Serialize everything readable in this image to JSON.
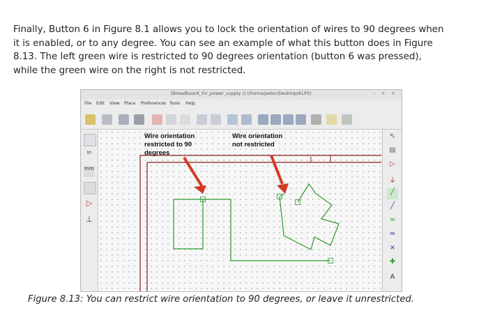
{
  "paragraph": {
    "lines": [
      "Finally, Button 6 in Figure 8.1 allows you to lock the orientation of wires to 90 degrees when",
      "it is enabled, or to any degree. You can see an example of what this button does in Figure",
      "8.13. The left green wire is restricted to 90 degrees orientation (button 6 was pressed),",
      "while the green wire on the right is not restricted."
    ]
  },
  "screenshot": {
    "window_title": "[Breadboard_5V_power_supply /] (/home/peter/Desktop/KLP2)",
    "window_controls": "– + ×",
    "menu": [
      "File",
      "Edit",
      "View",
      "Place",
      "Preferences",
      "Tools",
      "Help"
    ],
    "left_tools": {
      "inch": "In",
      "mm": "mm"
    },
    "annotations": {
      "left_line1": "Wire orientation",
      "left_line2": "restricted to 90",
      "left_line3": "degrees",
      "right_line1": "Wire orientation",
      "right_line2": "not restricted"
    },
    "sheet_label": "1",
    "right_tools": {
      "no_connect": "×",
      "text": "A"
    }
  },
  "caption": "Figure 8.13: You can restrict wire orientation to 90 degrees, or leave it unrestricted.",
  "colors": {
    "wire": "#2e9a2e",
    "sheet_border": "#8a1e1e",
    "arrow": "#d23a26",
    "text": "#222222"
  }
}
